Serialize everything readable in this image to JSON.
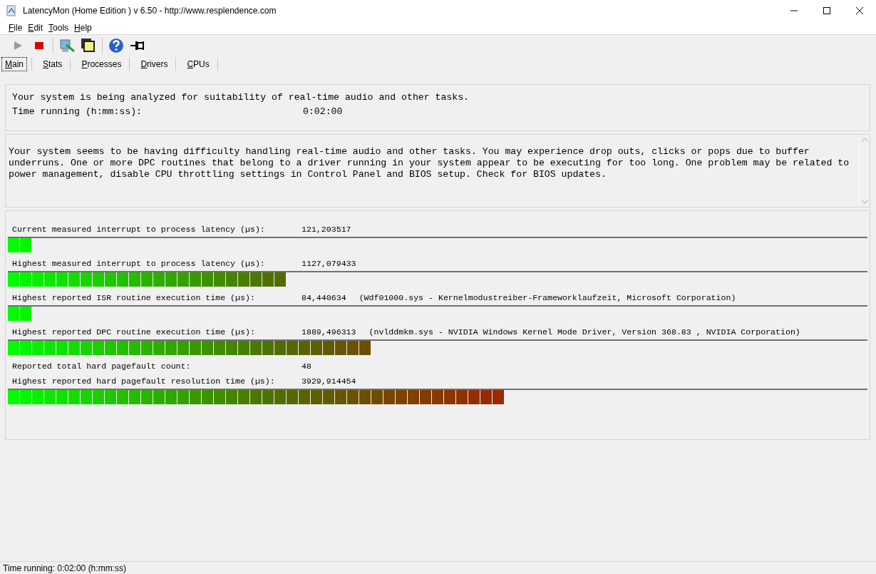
{
  "window": {
    "title": "LatencyMon  (Home Edition )  v 6.50 - http://www.resplendence.com"
  },
  "menu": [
    "File",
    "Edit",
    "Tools",
    "Help"
  ],
  "tabs": [
    {
      "label": "Main",
      "selected": true
    },
    {
      "label": "Stats",
      "selected": false
    },
    {
      "label": "Processes",
      "selected": false
    },
    {
      "label": "Drivers",
      "selected": false
    },
    {
      "label": "CPUs",
      "selected": false
    }
  ],
  "status_panel": {
    "message": "Your system is being analyzed for suitability of real-time audio and other tasks.",
    "time_label": "Time running (h:mm:ss):",
    "time_value": "0:02:00"
  },
  "diagnosis": "Your system seems to be having difficulty handling real-time audio and other tasks. You may experience drop outs, clicks or pops due to buffer underruns. One or more DPC routines that belong to a driver running in your system appear to be executing for too long. One problem may be related to power management, disable CPU throttling settings in Control Panel and BIOS setup. Check for BIOS updates.",
  "measurements": [
    {
      "label": "Current measured interrupt to process latency (µs):",
      "value": "121,203517",
      "level": 0.028
    },
    {
      "label": "Highest measured interrupt to process latency (µs):",
      "value": "1127,079433",
      "level": 0.323
    },
    {
      "label": "Highest reported ISR routine execution time (µs):",
      "value": "84,440634",
      "detail": "(Wdf01000.sys - Kernelmodustreiber-Frameworklaufzeit, Microsoft Corporation)",
      "level": 0.028
    },
    {
      "label": "Highest reported DPC routine execution time (µs):",
      "value": "1889,496313",
      "detail": "(nvlddmkm.sys - NVIDIA Windows Kernel Mode Driver, Version 368.83 , NVIDIA Corporation)",
      "level": 0.422
    },
    {
      "label": "Reported total hard pagefault count:",
      "value": "48"
    },
    {
      "label": "Highest reported hard pagefault resolution time (µs):",
      "value": "3929,914454",
      "level": 0.577
    }
  ],
  "status_bar": "Time running: 0:02:00  (h:mm:ss)"
}
